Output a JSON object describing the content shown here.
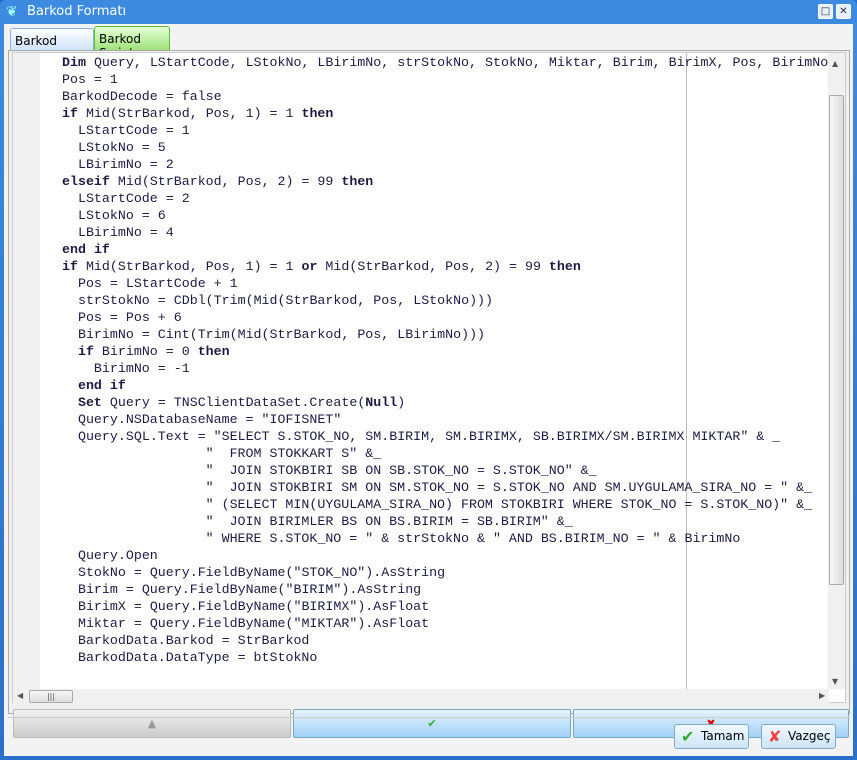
{
  "window": {
    "title": "Barkod Formatı",
    "icon": "butterfly-icon"
  },
  "tabs": [
    {
      "label": "Barkod Formatı"
    },
    {
      "label": "Barkod Script",
      "active": true
    }
  ],
  "editor": {
    "keywords": [
      "Dim",
      "if",
      "then",
      "elseif",
      "end",
      "or",
      "Set",
      "Null"
    ],
    "lines": [
      "Dim Query, LStartCode, LStokNo, LBirimNo, strStokNo, StokNo, Miktar, Birim, BirimX, Pos, BirimNo",
      "Pos = 1",
      "BarkodDecode = false",
      "if Mid(StrBarkod, Pos, 1) = 1 then",
      "  LStartCode = 1",
      "  LStokNo = 5",
      "  LBirimNo = 2",
      "elseif Mid(StrBarkod, Pos, 2) = 99 then",
      "  LStartCode = 2",
      "  LStokNo = 6",
      "  LBirimNo = 4",
      "end if",
      "if Mid(StrBarkod, Pos, 1) = 1 or Mid(StrBarkod, Pos, 2) = 99 then",
      "  Pos = LStartCode + 1",
      "  strStokNo = CDbl(Trim(Mid(StrBarkod, Pos, LStokNo)))",
      "  Pos = Pos + 6",
      "  BirimNo = Cint(Trim(Mid(StrBarkod, Pos, LBirimNo)))",
      "  if BirimNo = 0 then",
      "    BirimNo = -1",
      "  end if",
      "  Set Query = TNSClientDataSet.Create(Null)",
      "  Query.NSDatabaseName = \"IOFISNET\"",
      "  Query.SQL.Text = \"SELECT S.STOK_NO, SM.BIRIM, SM.BIRIMX, SB.BIRIMX/SM.BIRIMX MIKTAR\" & _",
      "                  \"  FROM STOKKART S\" &_",
      "                  \"  JOIN STOKBIRI SB ON SB.STOK_NO = S.STOK_NO\" &_",
      "                  \"  JOIN STOKBIRI SM ON SM.STOK_NO = S.STOK_NO AND SM.UYGULAMA_SIRA_NO = \" &_",
      "                  \" (SELECT MIN(UYGULAMA_SIRA_NO) FROM STOKBIRI WHERE STOK_NO = S.STOK_NO)\" &_",
      "                  \"  JOIN BIRIMLER BS ON BS.BIRIM = SB.BIRIM\" &_",
      "                  \" WHERE S.STOK_NO = \" & strStokNo & \" AND BS.BIRIM_NO = \" & BirimNo",
      "  Query.Open",
      "  StokNo = Query.FieldByName(\"STOK_NO\").AsString",
      "  Birim = Query.FieldByName(\"BIRIM\").AsString",
      "  BirimX = Query.FieldByName(\"BIRIMX\").AsFloat",
      "  Miktar = Query.FieldByName(\"MIKTAR\").AsFloat",
      "  BarkodData.Barkod = StrBarkod",
      "  BarkodData.DataType = btStokNo"
    ]
  },
  "navigator": {
    "prior": "▲",
    "post": "✔",
    "cancel": "✖"
  },
  "buttons": {
    "ok": "Tamam",
    "cancel": "Vazgeç"
  },
  "colors": {
    "title_bar": "#2a6fc9",
    "code_text": "#1c1c44",
    "ok_check": "#33aa33",
    "cancel_x": "#dd0000"
  }
}
